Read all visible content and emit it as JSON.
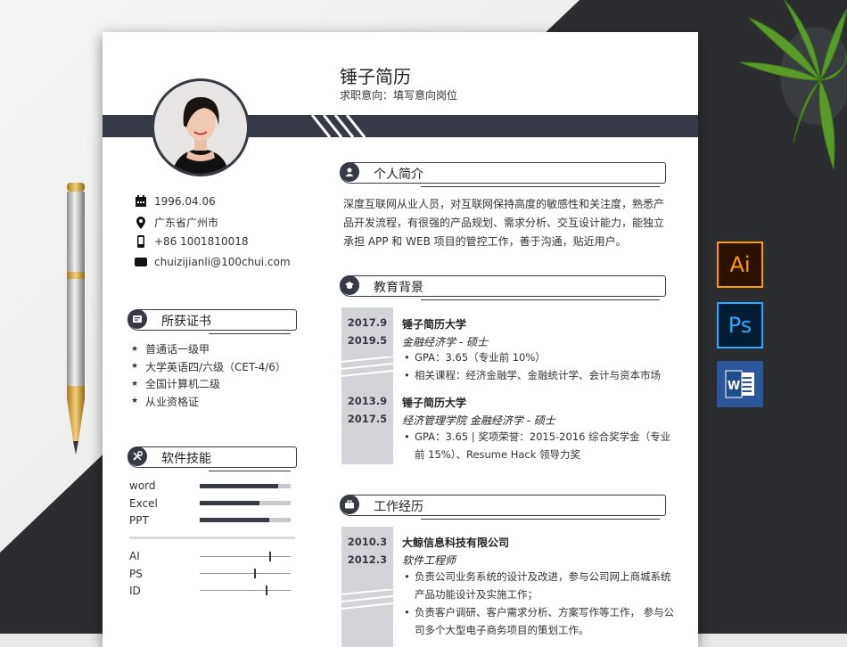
{
  "header": {
    "name": "锤子简历",
    "intent": "求职意向：填写意向岗位"
  },
  "contact": {
    "birth": "1996.04.06",
    "location": "广东省广州市",
    "phone": "+86 1001810018",
    "email": "chuizijianli@100chui.com"
  },
  "certs": {
    "title": "所获证书",
    "items": [
      "普通话一级甲",
      "大学英语四/六级（CET-4/6）",
      "全国计算机二级",
      "从业资格证"
    ]
  },
  "skills": {
    "title": "软件技能",
    "bars": [
      {
        "label": "word",
        "level": 0.86
      },
      {
        "label": "Excel",
        "level": 0.66
      },
      {
        "label": "PPT",
        "level": 0.76
      }
    ],
    "sliders": [
      {
        "label": "AI",
        "level": 0.76
      },
      {
        "label": "PS",
        "level": 0.6
      },
      {
        "label": "ID",
        "level": 0.73
      }
    ]
  },
  "intro": {
    "title": "个人简介",
    "text": "深度互联网从业人员，对互联网保持高度的敏感性和关注度，熟悉产品开发流程，有很强的产品规划、需求分析、交互设计能力，能独立承担 APP 和 WEB 项目的管控工作，善于沟通，贴近用户。"
  },
  "education": {
    "title": "教育背景",
    "entries": [
      {
        "start": "2017.9",
        "end": "2019.5",
        "school": "锤子简历大学",
        "major": "金融经济学 - 硕士",
        "bullets": [
          "GPA：3.65（专业前 10%）",
          "相关课程：经济金融学、金融统计学、会计与资本市场"
        ]
      },
      {
        "start": "2013.9",
        "end": "2017.5",
        "school": "锤子简历大学",
        "major": "经济管理学院 金融经济学 - 硕士",
        "bullets": [
          "GPA：3.65 | 奖项荣誉：2015-2016 综合奖学金（专业前 15%）、Resume Hack 领导力奖"
        ]
      }
    ]
  },
  "work": {
    "title": "工作经历",
    "entries": [
      {
        "start": "2010.3",
        "end": "2012.3",
        "company": "大鲸信息科技有限公司",
        "role": "软件工程师",
        "bullets": [
          "负责公司业务系统的设计及改进，参与公司网上商城系统产品功能设计及实施工作；",
          "负责客户调研、客户需求分析、方案写作等工作， 参与公司多个大型电子商务项目的策划工作。"
        ]
      }
    ]
  },
  "apps": {
    "ai": "Ai",
    "ps": "Ps"
  },
  "colors": {
    "dark": "#353a46",
    "date_bg": "#d3d4d8"
  }
}
